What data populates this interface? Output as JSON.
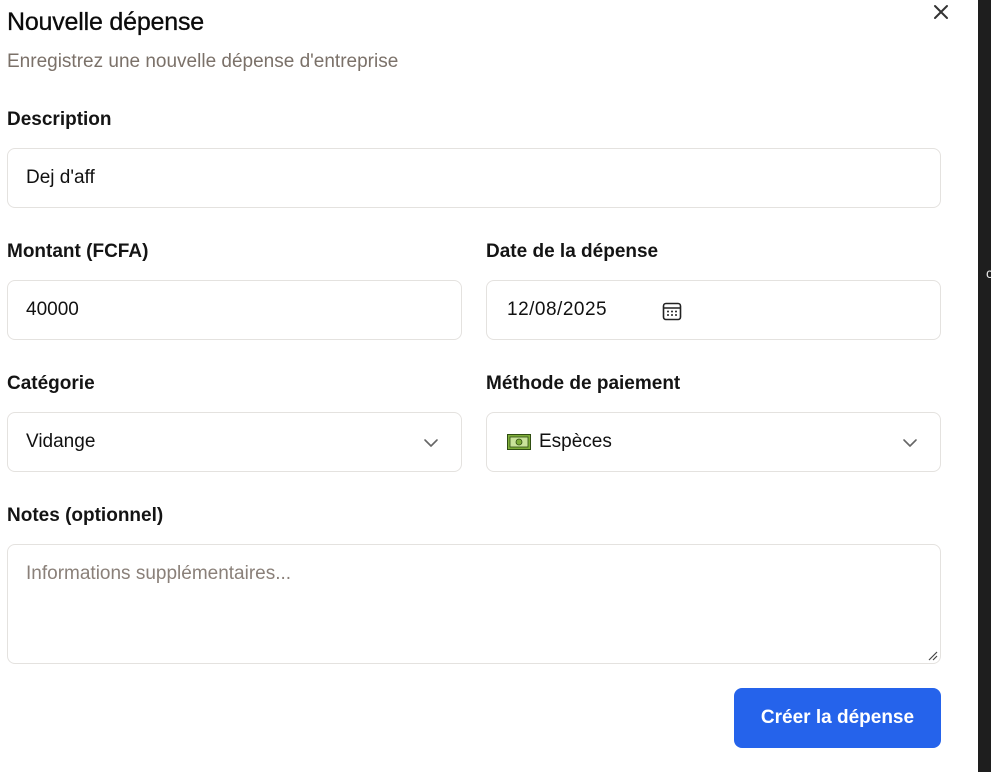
{
  "dialog": {
    "title": "Nouvelle dépense",
    "subtitle": "Enregistrez une nouvelle dépense d'entreprise",
    "close_icon": "close-icon"
  },
  "form": {
    "description": {
      "label": "Description",
      "value": "Dej d'aff"
    },
    "amount": {
      "label": "Montant (FCFA)",
      "value": "40000"
    },
    "date": {
      "label": "Date de la dépense",
      "value": "12/08/2025",
      "icon": "calendar-icon"
    },
    "category": {
      "label": "Catégorie",
      "value": "Vidange",
      "icon": "chevron-down-icon"
    },
    "payment_method": {
      "label": "Méthode de paiement",
      "value": "Espèces",
      "emoji_icon": "banknote-icon",
      "icon": "chevron-down-icon"
    },
    "notes": {
      "label": "Notes (optionnel)",
      "placeholder": "Informations supplémentaires..."
    }
  },
  "actions": {
    "submit_label": "Créer la dépense",
    "color": "#2563eb"
  },
  "colors": {
    "border": "#e4e2df",
    "muted_text": "#7b7169",
    "side_strip": "#1e1e1e"
  }
}
